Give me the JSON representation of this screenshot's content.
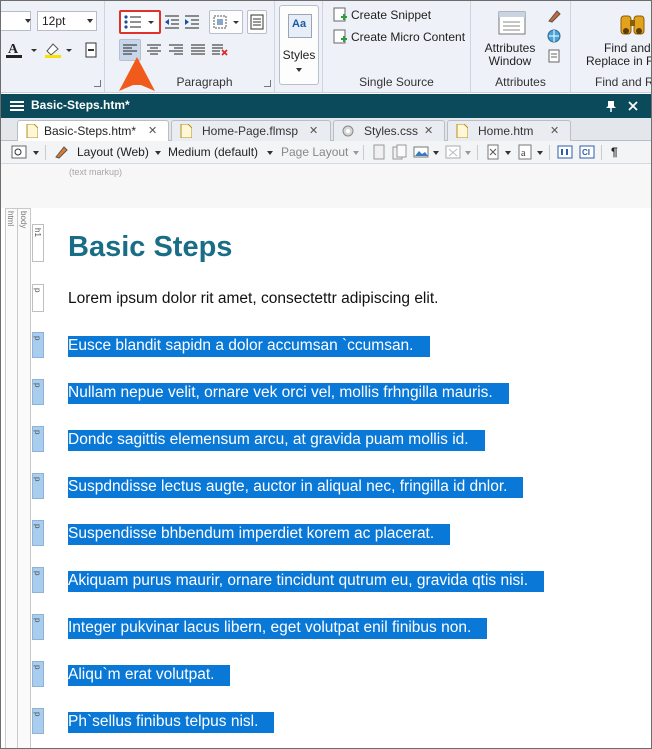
{
  "ribbon": {
    "font_size": "12pt",
    "groups": {
      "paragraph": "Paragraph",
      "styles": "Styles",
      "single_source": "Single Source",
      "attributes": "Attributes",
      "find_replace": "Find and R"
    },
    "styles_button": "Styles",
    "create_snippet": "Create Snippet",
    "create_micro_content": "Create Micro Content",
    "attributes_window_line1": "Attributes",
    "attributes_window_line2": "Window",
    "find_line1": "Find and",
    "find_line2": "Replace in Fi"
  },
  "window": {
    "title": "Basic-Steps.htm*"
  },
  "tabs": [
    {
      "label": "Basic-Steps.htm*",
      "active": true,
      "close": "✕"
    },
    {
      "label": "Home-Page.flmsp",
      "active": false,
      "close": "✕"
    },
    {
      "label": "Styles.css",
      "active": false,
      "close": "✕"
    },
    {
      "label": "Home.htm",
      "active": false,
      "close": "✕"
    }
  ],
  "editor_toolbar": {
    "layout": "Layout (Web)",
    "medium": "Medium (default)",
    "page_layout": "Page Layout",
    "pilcrow": "¶"
  },
  "editor": {
    "text_markup_label": "(text markup)",
    "tag_html": "html",
    "tag_body": "body",
    "tag_h1": "h1",
    "tag_p": "p",
    "heading": "Basic Steps",
    "intro": "Lorem ipsum dolor rit amet, consectettr adipiscing elit.",
    "selected_paragraphs": [
      "Eusce blandit sapidn a dolor accumsan `ccumsan.",
      "Nullam nepue velit, ornare vek orci vel, mollis frhngilla mauris.",
      "Dondc sagittis elemensum arcu, at gravida puam mollis id.",
      "Suspdndisse lectus augte, auctor in aliqual nec, fringilla id dnlor.",
      "Suspendisse bhbendum imperdiet korem ac placerat.",
      "Akiquam purus maurir, ornare tincidunt qutrum eu, gravida qtis nisi.",
      "Integer pukvinar lacus libern, eget volutpat enil finibus non.",
      "Aliqu`m erat volutpat.",
      "Ph`sellus finibus telpus nisl."
    ]
  },
  "colors": {
    "window_bar": "#0b4a5a",
    "heading": "#1a6d86",
    "selection": "#0a78d7",
    "highlight_box": "#e0322a",
    "arrow": "#f05a1a"
  }
}
